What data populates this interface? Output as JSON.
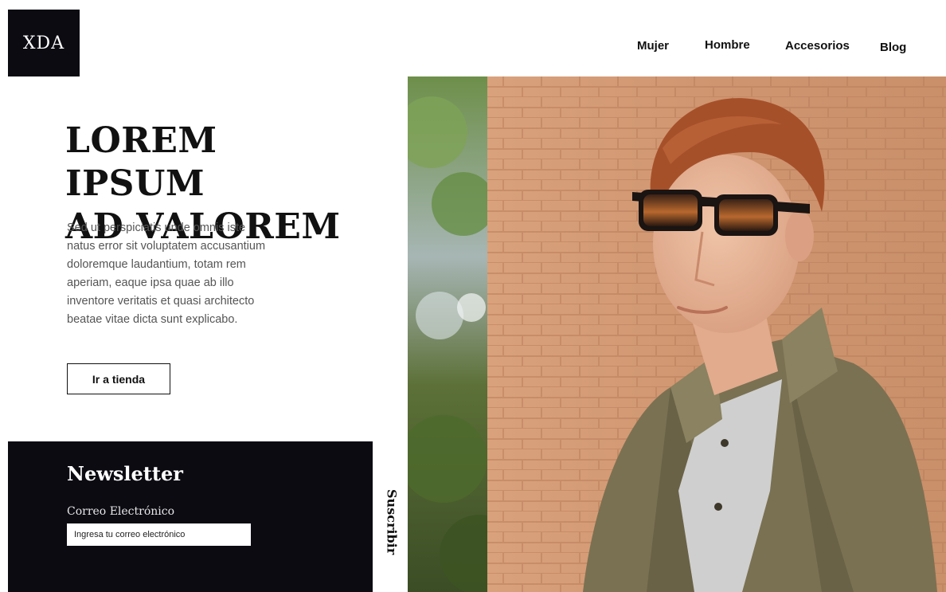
{
  "brand": {
    "logo_text": "XDA"
  },
  "nav": {
    "items": [
      {
        "label": "Mujer"
      },
      {
        "label": "Hombre"
      },
      {
        "label": "Accesorios"
      },
      {
        "label": "Blog"
      }
    ]
  },
  "hero": {
    "title_line1": "LOREM IPSUM",
    "title_line2": "AD VALOREM",
    "body": "Sed ut perspiciatis unde omnis iste natus error sit voluptatem accusantium doloremque laudantium, totam rem aperiam, eaque ipsa quae ab illo inventore veritatis et quasi architecto beatae vitae dicta sunt explicabo.",
    "cta_label": "Ir a tienda"
  },
  "newsletter": {
    "title": "Newsletter",
    "email_label": "Correo Electrónico",
    "email_placeholder": "Ingresa tu correo electrónico",
    "email_value": "",
    "subscribe_label": "Suscribir"
  },
  "colors": {
    "dark": "#0c0b12",
    "text": "#111111",
    "muted_text": "#555555",
    "brick": "#c9906a",
    "jacket": "#7a7152"
  },
  "icons": {
    "logo": "brand-logo-tile"
  }
}
